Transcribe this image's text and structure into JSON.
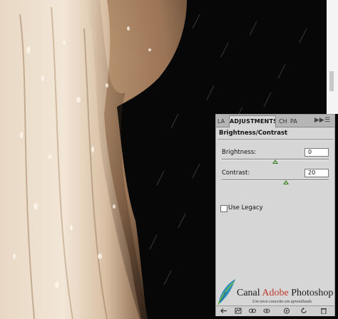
{
  "panel": {
    "tabs": [
      {
        "label": "LA"
      },
      {
        "label": "ADJUSTMENTS"
      },
      {
        "label": "CH"
      },
      {
        "label": "PA"
      }
    ],
    "collapse_icon": "double-right-arrow-icon",
    "menu_icon": "panel-menu-icon",
    "title": "Brightness/Contrast",
    "brightness": {
      "label": "Brightness:",
      "value": "0",
      "slider_fraction": 0.5
    },
    "contrast": {
      "label": "Contrast:",
      "value": "20",
      "slider_fraction": 0.6
    },
    "use_legacy": {
      "label": "Use Legacy",
      "checked": false
    },
    "bottom_icons": [
      "return-arrow-icon",
      "adjustments-list-icon",
      "clip-layer-icon",
      "visibility-eye-icon",
      "view-previous-icon",
      "reset-icon",
      "delete-icon"
    ]
  },
  "watermark": {
    "brand_words": [
      "Canal",
      "Adobe",
      "Photoshop"
    ],
    "tagline": "Um novo conceito em aprendizado"
  },
  "colors": {
    "panel_bg": "#d6d6d6",
    "slider_thumb": "#3a7a2a",
    "brand_red": "#c0392b"
  }
}
